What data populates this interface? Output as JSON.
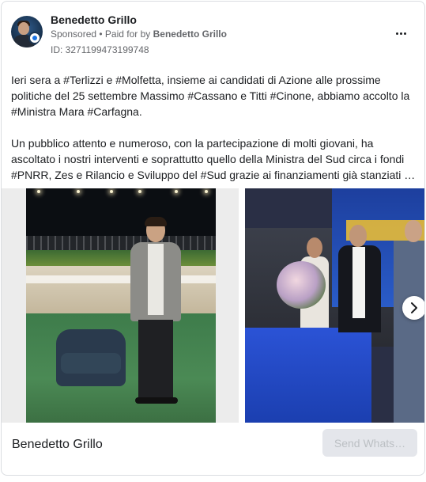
{
  "post": {
    "page_name": "Benedetto Grillo",
    "sponsored_label": "Sponsored",
    "separator": " • ",
    "paid_for_prefix": "Paid for by ",
    "paid_for_name": "Benedetto Grillo",
    "ad_id": "ID: 3271199473199748",
    "paragraph_1": "Ieri sera a #Terlizzi e #Molfetta, insieme ai candidati di Azione alle prossime politiche del 25 settembre Massimo #Cassano e Titti #Cinone, abbiamo accolto la #Ministra Mara #Carfagna.",
    "paragraph_2_lines": [
      "Un pubblico attento e numeroso, con la partecipazione di molti giovani, ha",
      "ascoltato i nostri interventi e soprattutto quello della Ministra del Sud circa i fondi"
    ],
    "paragraph_2_truncated": "#PNRR, Zes e Rilancio e Sviluppo del #Sud grazie ai finanziamenti già stanziati d…"
  },
  "icons": {
    "more": "more-horizontal-icon",
    "next": "chevron-right-icon",
    "verified_badge": "page-badge-icon"
  },
  "footer": {
    "page_name": "Benedetto Grillo",
    "cta_label": "Send Whats…"
  },
  "colors": {
    "text_primary": "#1c1e21",
    "text_secondary": "#65676b",
    "cta_background": "#e4e6eb",
    "cta_text": "#bcc0c4",
    "card_border": "#dadde1"
  }
}
